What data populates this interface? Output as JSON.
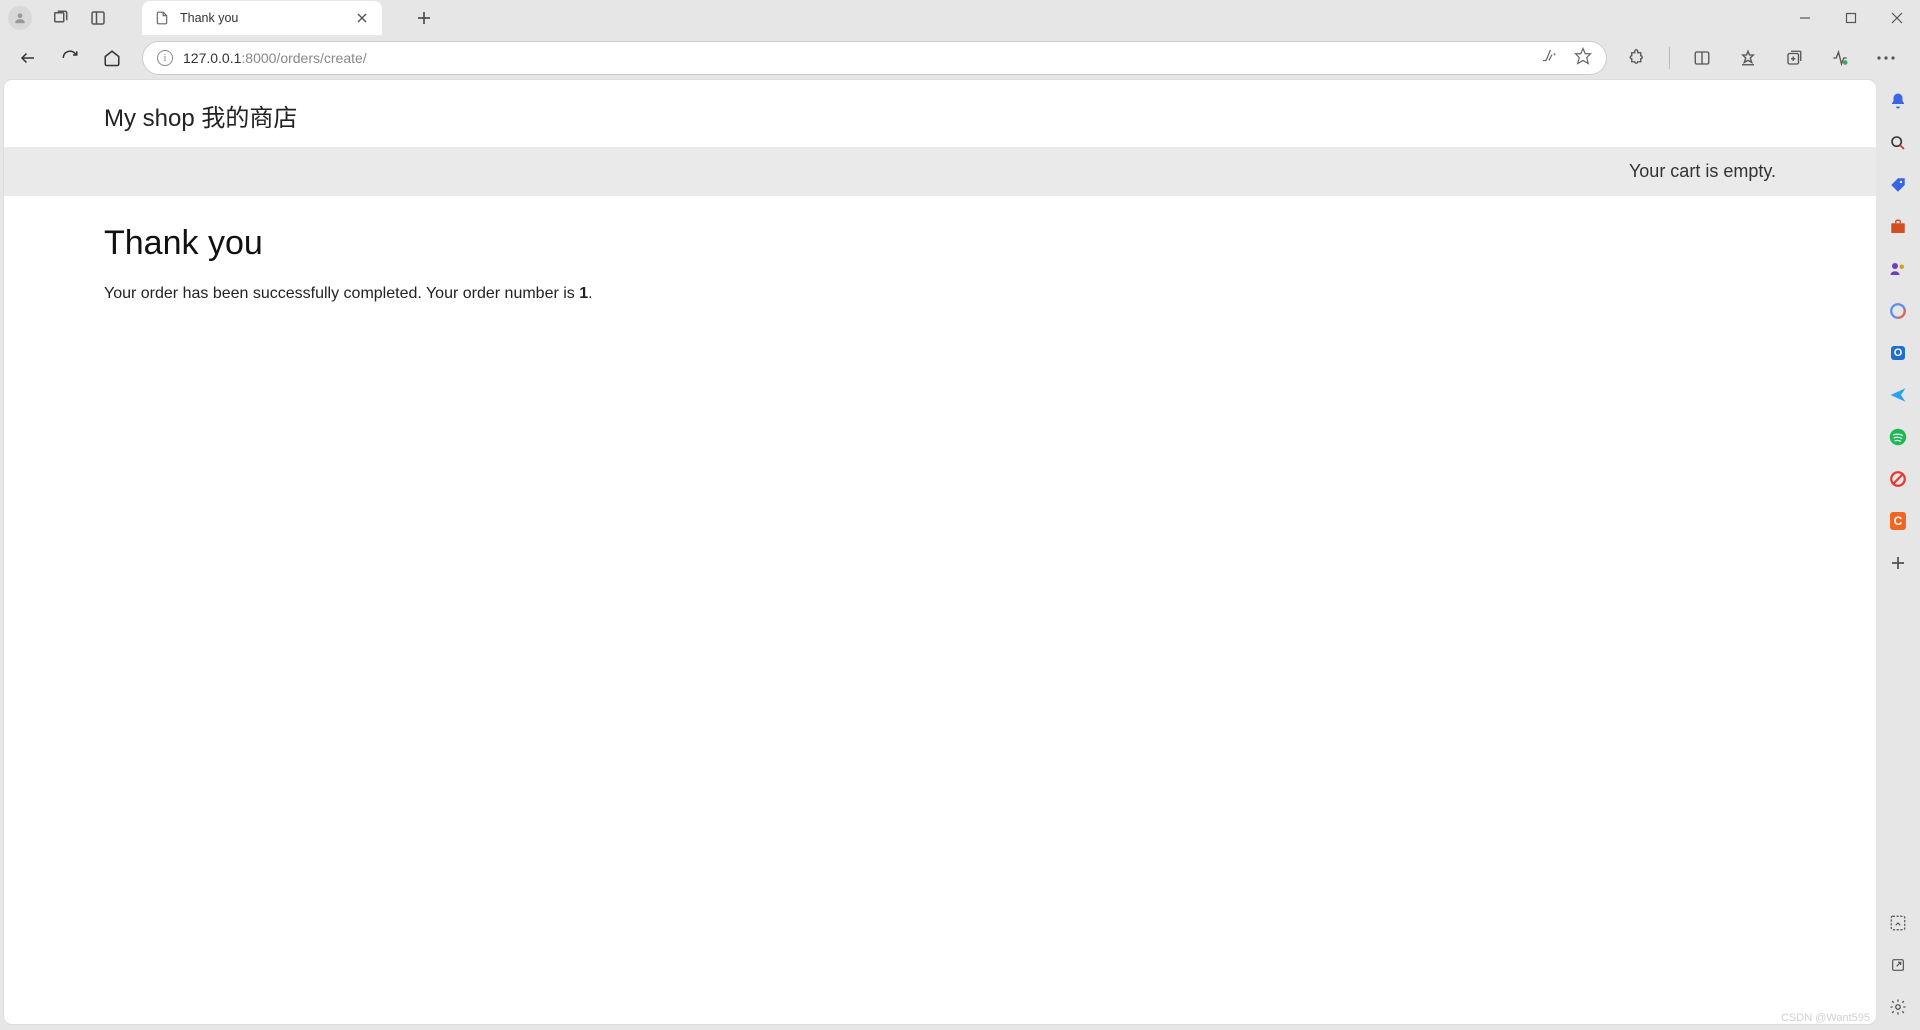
{
  "browser": {
    "tab_title": "Thank you",
    "url_host": "127.0.0.1",
    "url_port_path": ":8000/orders/create/"
  },
  "site": {
    "header_title": "My shop 我的商店",
    "cart_status": "Your cart is empty."
  },
  "page": {
    "heading": "Thank you",
    "message_before": "Your order has been successfully completed. Your order number is ",
    "order_number": "1",
    "message_after": "."
  },
  "watermark": "CSDN @Want595"
}
